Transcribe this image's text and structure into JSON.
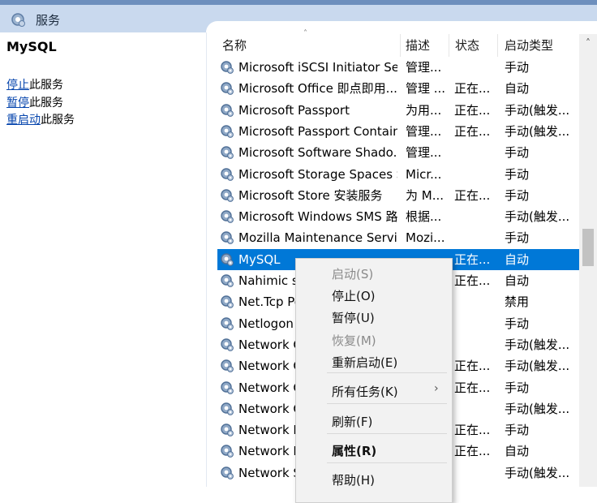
{
  "window": {
    "title": "服务"
  },
  "left_pane": {
    "service_name": "MySQL",
    "actions": [
      {
        "link": "停止",
        "suffix": "此服务"
      },
      {
        "link": "暂停",
        "suffix": "此服务"
      },
      {
        "link": "重启动",
        "suffix": "此服务"
      }
    ]
  },
  "columns": {
    "name": "名称",
    "description": "描述",
    "status": "状态",
    "startup_type": "启动类型"
  },
  "services": [
    {
      "name": "Microsoft iSCSI Initiator Ser...",
      "description": "管理...",
      "status": "",
      "startup": "手动"
    },
    {
      "name": "Microsoft Office 即点即用...",
      "description": "管理 ...",
      "status": "正在...",
      "startup": "自动"
    },
    {
      "name": "Microsoft Passport",
      "description": "为用...",
      "status": "正在...",
      "startup": "手动(触发..."
    },
    {
      "name": "Microsoft Passport Container",
      "description": "管理...",
      "status": "正在...",
      "startup": "手动(触发..."
    },
    {
      "name": "Microsoft Software Shado...",
      "description": "管理...",
      "status": "",
      "startup": "手动"
    },
    {
      "name": "Microsoft Storage Spaces S...",
      "description": "Micr...",
      "status": "",
      "startup": "手动"
    },
    {
      "name": "Microsoft Store 安装服务",
      "description": "为 M...",
      "status": "正在...",
      "startup": "手动"
    },
    {
      "name": "Microsoft Windows SMS 路...",
      "description": "根据...",
      "status": "",
      "startup": "手动(触发..."
    },
    {
      "name": "Mozilla Maintenance Service",
      "description": "Mozi...",
      "status": "",
      "startup": "手动"
    },
    {
      "name": "MySQL",
      "description": "",
      "status": "正在...",
      "startup": "自动",
      "selected": true
    },
    {
      "name": "Nahimic se",
      "description": "",
      "status": "正在...",
      "startup": "自动"
    },
    {
      "name": "Net.Tcp Po",
      "description": "",
      "status": "",
      "startup": "禁用"
    },
    {
      "name": "Netlogon",
      "description": "",
      "status": "",
      "startup": "手动"
    },
    {
      "name": "Network C",
      "description": "",
      "status": "",
      "startup": "手动(触发..."
    },
    {
      "name": "Network C",
      "description": "",
      "status": "正在...",
      "startup": "手动(触发..."
    },
    {
      "name": "Network C",
      "description": "",
      "status": "正在...",
      "startup": "手动"
    },
    {
      "name": "Network C",
      "description": "",
      "status": "",
      "startup": "手动(触发..."
    },
    {
      "name": "Network L",
      "description": "",
      "status": "正在...",
      "startup": "手动"
    },
    {
      "name": "Network L",
      "description": "",
      "status": "正在...",
      "startup": "自动"
    },
    {
      "name": "Network S",
      "description": "",
      "status": "",
      "startup": "手动(触发..."
    }
  ],
  "context_menu": {
    "items": [
      {
        "label": "启动(S)",
        "disabled": true
      },
      {
        "label": "停止(O)"
      },
      {
        "label": "暂停(U)"
      },
      {
        "label": "恢复(M)",
        "disabled": true
      },
      {
        "label": "重新启动(E)"
      },
      {
        "label": "所有任务(K)",
        "submenu": true
      },
      {
        "label": "刷新(F)"
      },
      {
        "label": "属性(R)",
        "bold": true
      },
      {
        "label": "帮助(H)"
      }
    ],
    "submenu_arrow": "›"
  },
  "scrollbar": {
    "up_arrow": "˄"
  },
  "colors": {
    "selection": "#0078d7",
    "titlebar": "#c9d9ee",
    "link": "#0645ad"
  }
}
